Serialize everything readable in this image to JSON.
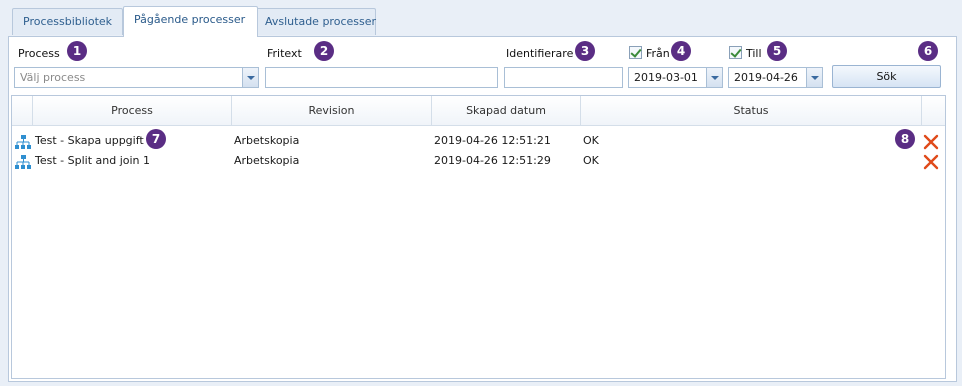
{
  "tabs": [
    {
      "label": "Processbibliotek"
    },
    {
      "label": "Pågående processer"
    },
    {
      "label": "Avslutade processer"
    }
  ],
  "filters": {
    "process": {
      "label": "Process",
      "placeholder": "Välj process"
    },
    "fritext": {
      "label": "Fritext",
      "value": ""
    },
    "identifierare": {
      "label": "Identifierare",
      "value": ""
    },
    "fran": {
      "label": "Från",
      "checked": true,
      "value": "2019-03-01"
    },
    "till": {
      "label": "Till",
      "checked": true,
      "value": "2019-04-26"
    },
    "search_label": "Sök"
  },
  "badges": [
    "1",
    "2",
    "3",
    "4",
    "5",
    "6",
    "7",
    "8"
  ],
  "table": {
    "columns": [
      "Process",
      "Revision",
      "Skapad datum",
      "Status"
    ],
    "rows": [
      {
        "icon": "process-tree-icon",
        "process": "Test - Skapa uppgift",
        "revision": "Arbetskopia",
        "created": "2019-04-26 12:51:21",
        "status": "OK",
        "action": "delete-icon"
      },
      {
        "icon": "process-tree-icon",
        "process": "Test - Split and join 1",
        "revision": "Arbetskopia",
        "created": "2019-04-26 12:51:29",
        "status": "OK",
        "action": "delete-icon"
      }
    ]
  },
  "colors": {
    "accent": "#5a2d84",
    "delete": "#e04a1a",
    "tab_text": "#2f5f8f"
  }
}
